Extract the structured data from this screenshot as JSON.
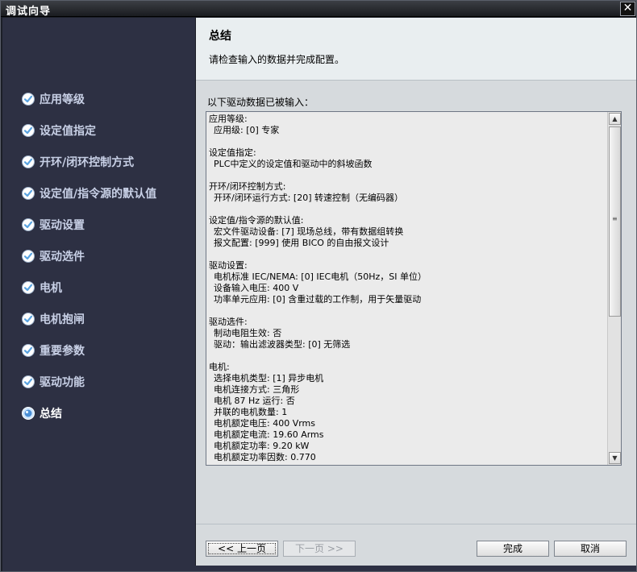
{
  "window": {
    "title": "调试向导",
    "close_glyph": "✕"
  },
  "sidebar": {
    "items": [
      {
        "label": "应用等级",
        "state": "done"
      },
      {
        "label": "设定值指定",
        "state": "done"
      },
      {
        "label": "开环/闭环控制方式",
        "state": "done"
      },
      {
        "label": "设定值/指令源的默认值",
        "state": "done"
      },
      {
        "label": "驱动设置",
        "state": "done"
      },
      {
        "label": "驱动选件",
        "state": "done"
      },
      {
        "label": "电机",
        "state": "done"
      },
      {
        "label": "电机抱闸",
        "state": "done"
      },
      {
        "label": "重要参数",
        "state": "done"
      },
      {
        "label": "驱动功能",
        "state": "done"
      },
      {
        "label": "总结",
        "state": "current"
      }
    ]
  },
  "header": {
    "title": "总结",
    "description": "请检查输入的数据并完成配置。"
  },
  "content": {
    "intro": "以下驱动数据已被输入：",
    "sections": [
      {
        "heading": "应用等级:",
        "lines": [
          "应用级: [0] 专家"
        ]
      },
      {
        "heading": "设定值指定:",
        "lines": [
          "PLC中定义的设定值和驱动中的斜坡函数"
        ]
      },
      {
        "heading": "开环/闭环控制方式:",
        "lines": [
          "开环/闭环运行方式: [20] 转速控制（无编码器）"
        ]
      },
      {
        "heading": "设定值/指令源的默认值:",
        "lines": [
          "宏文件驱动设备: [7] 现场总线，带有数据组转换",
          "报文配置: [999] 使用 BICO 的自由报文设计"
        ]
      },
      {
        "heading": "驱动设置:",
        "lines": [
          "电机标准 IEC/NEMA: [0] IEC电机（50Hz，SI 单位）",
          "设备输入电压: 400 V",
          "功率单元应用: [0] 含重过载的工作制，用于矢量驱动"
        ]
      },
      {
        "heading": "驱动选件:",
        "lines": [
          "制动电阻生效: 否",
          "驱动：输出滤波器类型: [0] 无筛选"
        ]
      },
      {
        "heading": "电机:",
        "lines": [
          "选择电机类型: [1] 异步电机",
          "电机连接方式: 三角形",
          "电机 87 Hz 运行: 否",
          "并联的电机数量: 1",
          "电机额定电压: 400 Vrms",
          "电机额定电流: 19.60 Arms",
          "电机额定功率: 9.20 kW",
          "电机额定功率因数: 0.770"
        ]
      }
    ]
  },
  "footer": {
    "prev_label": "<< 上一页",
    "next_label": "下一页 >>",
    "finish_label": "完成",
    "cancel_label": "取消"
  },
  "colors": {
    "sidebar_bg": "#2d3043",
    "done_icon": "#5aa3e0",
    "current_icon": "#cfe6ff"
  },
  "icons": {
    "done": "check-circle-icon",
    "current": "radio-dot-icon"
  }
}
